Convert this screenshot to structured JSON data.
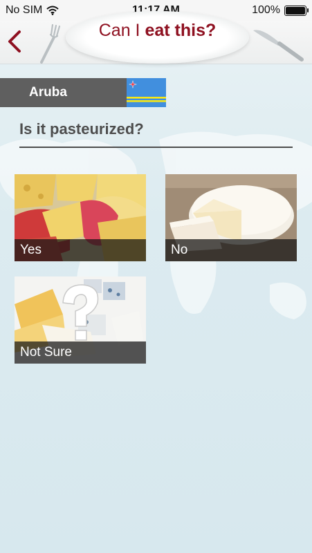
{
  "status_bar": {
    "carrier": "No SIM",
    "time": "11:17 AM",
    "battery_percent": "100%",
    "battery_level": 1.0
  },
  "nav": {
    "logo_prefix": "Can I ",
    "logo_main": "eat this?"
  },
  "country": {
    "name": "Aruba",
    "flag": "aruba-flag"
  },
  "question": "Is it pasteurized?",
  "options": [
    {
      "label": "Yes",
      "image": "assorted-cheeses"
    },
    {
      "label": "No",
      "image": "brie-wheel"
    },
    {
      "label": "Not Sure",
      "image": "cheeses-with-question-mark"
    }
  ],
  "colors": {
    "brand": "#8e1020",
    "banner": "#5f5f5f",
    "question_text": "#4d4d4d",
    "background": "#dcebf0"
  }
}
